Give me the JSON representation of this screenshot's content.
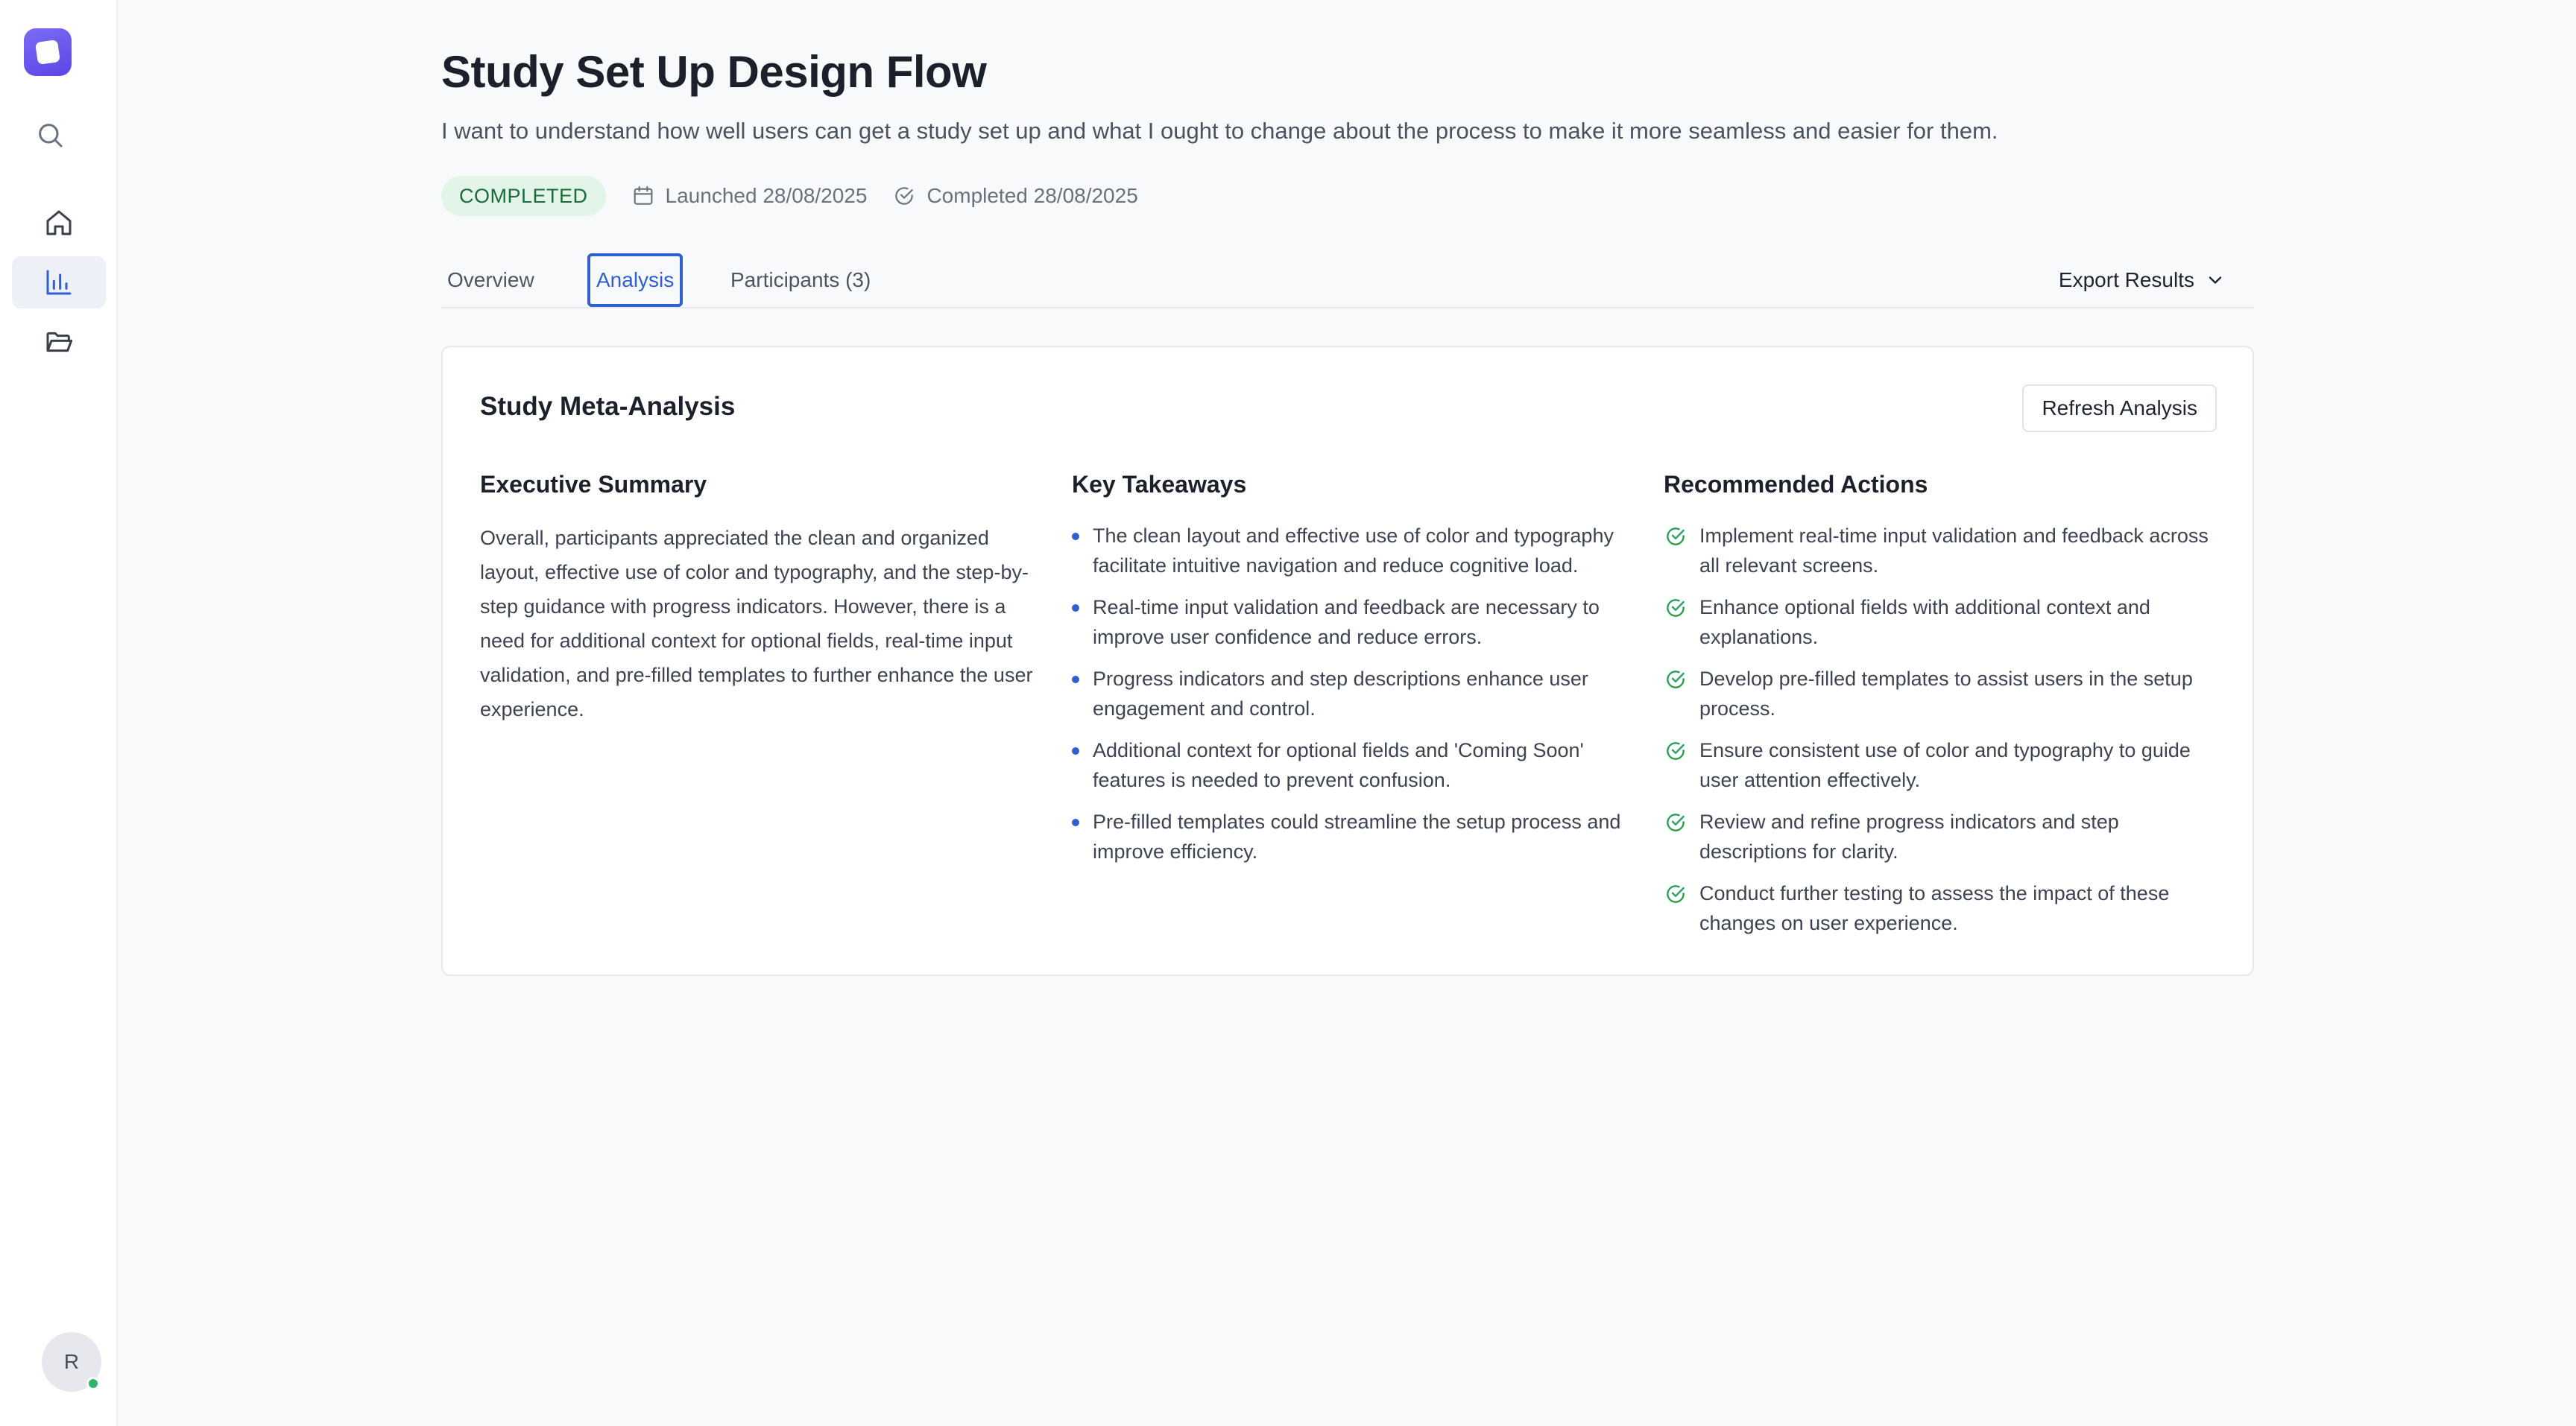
{
  "sidebar": {
    "logo_icon": "app-logo",
    "items": [
      {
        "name": "search",
        "icon": "search-icon"
      },
      {
        "name": "home",
        "icon": "home-icon"
      },
      {
        "name": "analytics",
        "icon": "bar-chart-icon",
        "active": true
      },
      {
        "name": "folders",
        "icon": "folder-open-icon"
      }
    ],
    "avatar_initial": "R",
    "status_color": "#2fb56a"
  },
  "header": {
    "title": "Study Set Up Design Flow",
    "description": "I want to understand how well users can get a study set up and what I ought to change about the process to make it more seamless and easier for them.",
    "status_badge": "COMPLETED",
    "launched": "Launched 28/08/2025",
    "completed": "Completed 28/08/2025"
  },
  "tabs": [
    {
      "label": "Overview",
      "active": false
    },
    {
      "label": "Analysis",
      "active": true
    },
    {
      "label": "Participants (3)",
      "active": false
    }
  ],
  "export_label": "Export Results",
  "card": {
    "title": "Study Meta-Analysis",
    "refresh_label": "Refresh Analysis",
    "executive_summary": {
      "title": "Executive Summary",
      "text": "Overall, participants appreciated the clean and organized layout, effective use of color and typography, and the step-by-step guidance with progress indicators. However, there is a need for additional context for optional fields, real-time input validation, and pre-filled templates to further enhance the user experience."
    },
    "key_takeaways": {
      "title": "Key Takeaways",
      "items": [
        "The clean layout and effective use of color and typography facilitate intuitive navigation and reduce cognitive load.",
        "Real-time input validation and feedback are necessary to improve user confidence and reduce errors.",
        "Progress indicators and step descriptions enhance user engagement and control.",
        "Additional context for optional fields and 'Coming Soon' features is needed to prevent confusion.",
        "Pre-filled templates could streamline the setup process and improve efficiency."
      ]
    },
    "recommended_actions": {
      "title": "Recommended Actions",
      "items": [
        "Implement real-time input validation and feedback across all relevant screens.",
        "Enhance optional fields with additional context and explanations.",
        "Develop pre-filled templates to assist users in the setup process.",
        "Ensure consistent use of color and typography to guide user attention effectively.",
        "Review and refine progress indicators and step descriptions for clarity.",
        "Conduct further testing to assess the impact of these changes on user experience."
      ]
    }
  },
  "colors": {
    "accent": "#2f5fd0",
    "badge_bg": "#e3f4e8",
    "badge_text": "#1d6b3b",
    "check_green": "#2f9e57",
    "brand": "#5b45e6"
  }
}
